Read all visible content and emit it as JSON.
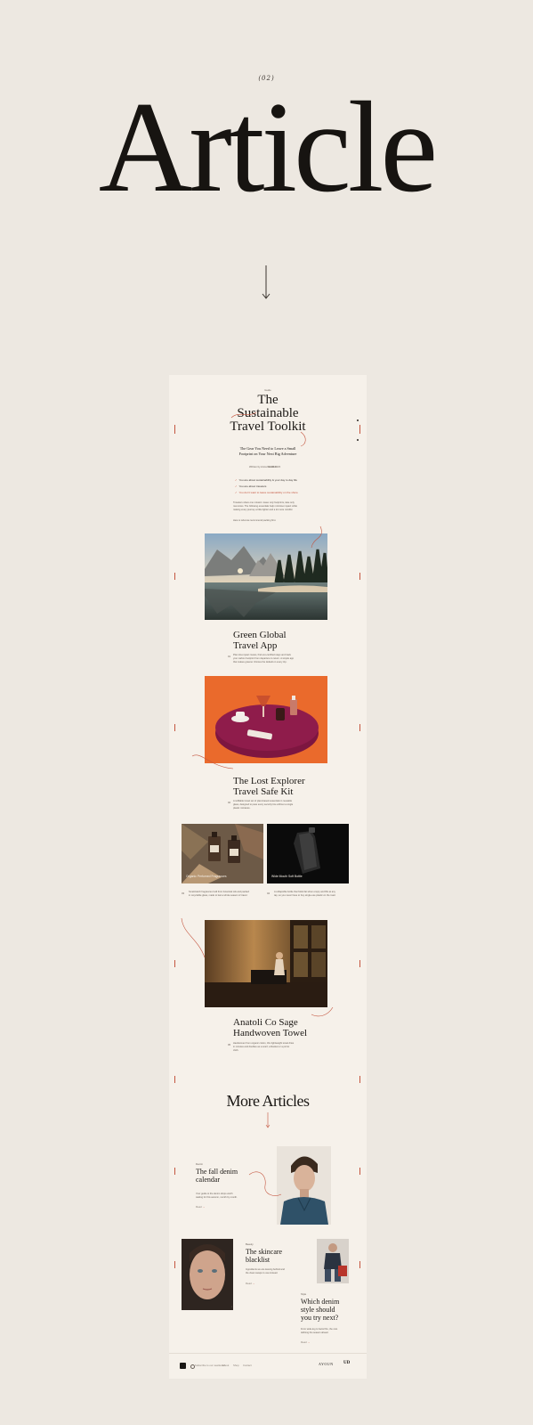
{
  "hero": {
    "section_number": "(02)",
    "title": "Article"
  },
  "article": {
    "kicker": "Guide",
    "title_lines": [
      "The",
      "Sustainable",
      "Travel Toolkit"
    ],
    "subtitle_lines": [
      "The Gear You Need to Leave a Small",
      "Footprint on Your Next Big Adventure"
    ],
    "byline": "Written by Anna Dowson",
    "date": "12.08.2023",
    "checklist": [
      "You are about sustainability & your day to day life",
      "You are about travelers",
      "You don't want to leave sustainability on the shore"
    ],
    "intro": "Travelers share one mission: leave only footprints, take only memories. The following essentials help minimise impact while making every journey a little lighter and a lot more mindful.",
    "intro_note": "Here is what we recommend packing first.",
    "sections": [
      {
        "number": "01",
        "title_lines": [
          "Green Global",
          "Travel App"
        ],
        "body": "Plan low-impact routes, find eco-certified stays and track your carbon footprint from departure to return. A simple app that makes greener choices the default on every trip."
      },
      {
        "number": "02",
        "title_lines": [
          "The Lost Explorer",
          "Travel Safe Kit"
        ],
        "body": "A refillable travel set of plant-based essentials in reusable glass, designed to pass every security line without a single plastic miniature."
      },
      {
        "number": "03",
        "caption": "Organic Perfumed Fragrances",
        "body": "Small-batch fragrances built from botanical oils and packed in recyclable glass, made to last a whole season of travel."
      },
      {
        "number": "04",
        "caption": "Wide Mouth Soft Bottle",
        "body": "A collapsible bottle that folds flat when empty and fills at any tap, so you never have to buy single-use plastic on the road."
      },
      {
        "number": "05",
        "title_lines": [
          "Anatoli Co Sage",
          "Handwoven Towel"
        ],
        "body": "Handwoven from organic cotton, this lightweight towel dries in minutes and doubles as a scarf, a blanket or a picnic cloth."
      }
    ]
  },
  "more_articles": {
    "heading": "More Articles",
    "items": [
      {
        "tag": "Denim",
        "title_lines": [
          "The fall denim",
          "calendar"
        ],
        "body": "Your guide to the denim drops worth waiting for this autumn, month by month.",
        "read_more": "Read"
      },
      {
        "tag": "Beauty",
        "title_lines": [
          "The skincare",
          "blacklist"
        ],
        "body": "Ingredients we are leaving behind and the clean swaps to use instead.",
        "read_more": "Read"
      },
      {
        "tag": "Style",
        "title_lines": [
          "Which denim",
          "style should",
          "you try next?"
        ],
        "body": "From wide-leg to barrel fits, the cuts defining the season ahead.",
        "read_more": "Read"
      }
    ]
  },
  "footer": {
    "subscribe": "Subscribe to our newsletter",
    "links": [
      "About",
      "Shop",
      "Contact"
    ],
    "brand": "AYOUN",
    "mark": "UD"
  },
  "colors": {
    "background": "#ede8e1",
    "card": "#f6f1ea",
    "accent": "#c4553f",
    "ink": "#1a1714"
  }
}
